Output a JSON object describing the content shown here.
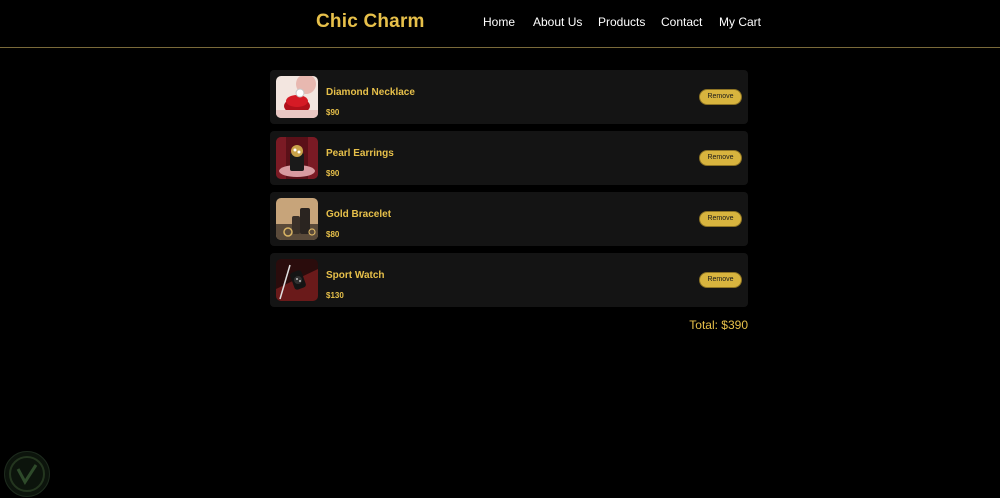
{
  "header": {
    "brand": "Chic Charm",
    "nav": [
      "Home",
      "About Us",
      "Products",
      "Contact",
      "My Cart"
    ]
  },
  "cart": {
    "items": [
      {
        "name": "Diamond Necklace",
        "price": "$90",
        "remove_label": "Remove",
        "image_icon": "necklace-image"
      },
      {
        "name": "Pearl Earrings",
        "price": "$90",
        "remove_label": "Remove",
        "image_icon": "earrings-image"
      },
      {
        "name": "Gold Bracelet",
        "price": "$80",
        "remove_label": "Remove",
        "image_icon": "bracelet-image"
      },
      {
        "name": "Sport Watch",
        "price": "$130",
        "remove_label": "Remove",
        "image_icon": "watch-image"
      }
    ],
    "total": "Total: $390"
  },
  "colors": {
    "background": "#000000",
    "accent": "#e7c04a",
    "card": "#141414",
    "button": "#d8b43e"
  }
}
